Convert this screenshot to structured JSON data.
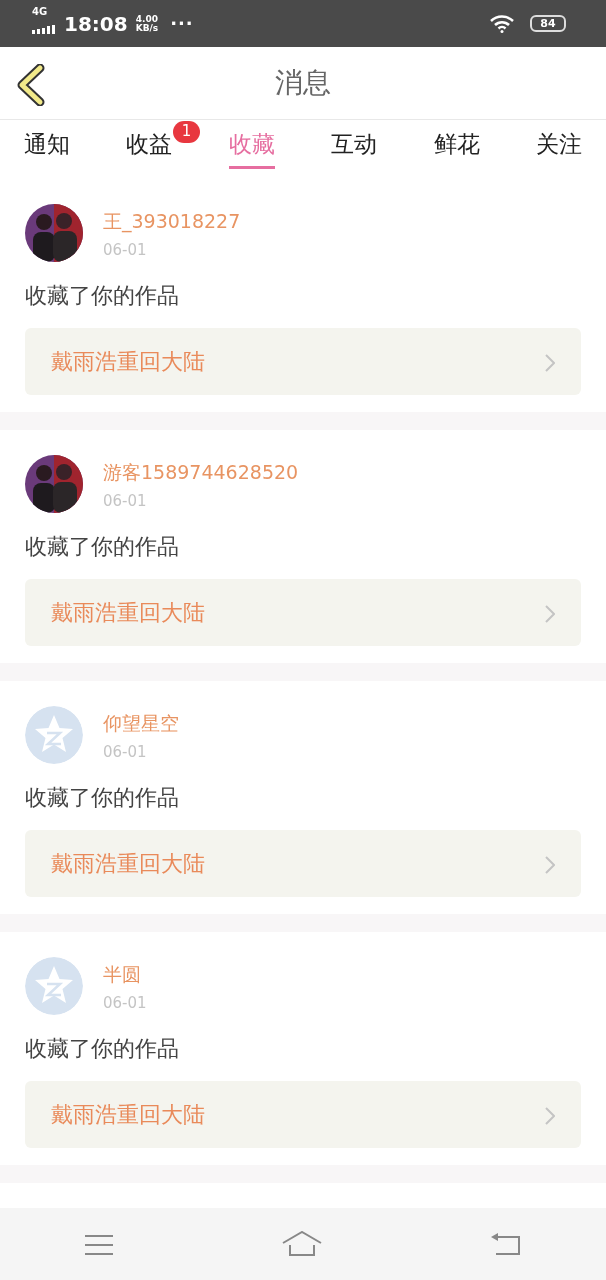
{
  "status_bar": {
    "network": "4G",
    "time": "18:08",
    "speed_value": "4.00",
    "speed_unit": "KB/s",
    "more": "···",
    "battery": "84"
  },
  "header": {
    "title": "消息"
  },
  "tabs": [
    {
      "label": "通知",
      "selected": false
    },
    {
      "label": "收益",
      "selected": false,
      "badge": "1"
    },
    {
      "label": "收藏",
      "selected": true
    },
    {
      "label": "互动",
      "selected": false
    },
    {
      "label": "鲜花",
      "selected": false
    },
    {
      "label": "关注",
      "selected": false
    }
  ],
  "messages": [
    {
      "name": "王_393018227",
      "date": "06-01",
      "text": "收藏了你的作品",
      "work": "戴雨浩重回大陆"
    },
    {
      "name": "游客1589744628520",
      "date": "06-01",
      "text": "收藏了你的作品",
      "work": "戴雨浩重回大陆"
    },
    {
      "avatar": {
        "kind": "default"
      },
      "name": "仰望星空",
      "date": "06-01",
      "text": "收藏了你的作品",
      "work": "戴雨浩重回大陆"
    },
    {
      "avatar": {
        "kind": "default"
      },
      "name": "半圆",
      "date": "06-01",
      "text": "收藏了你的作品",
      "work": "戴雨浩重回大陆"
    }
  ]
}
